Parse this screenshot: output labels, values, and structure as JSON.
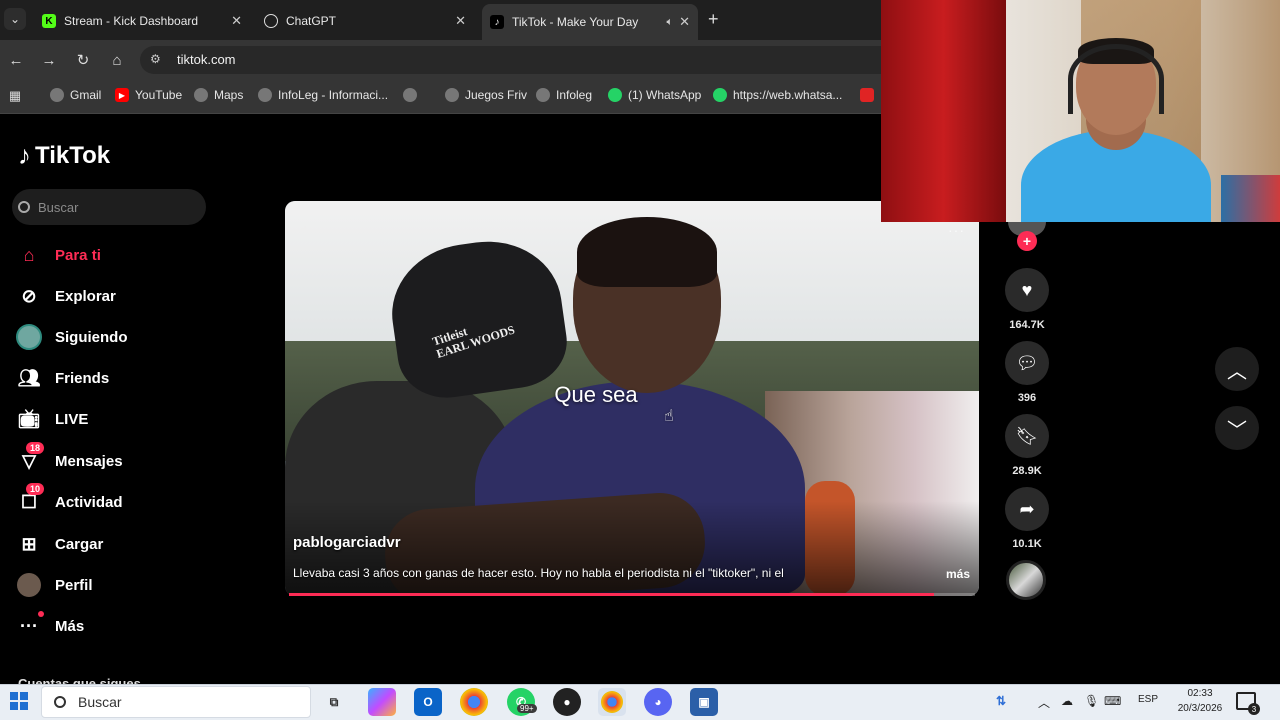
{
  "browser": {
    "tabs": [
      {
        "title": "Stream - Kick Dashboard",
        "favicon": "K",
        "favicon_color": "#53fc18"
      },
      {
        "title": "ChatGPT",
        "favicon": "✦",
        "favicon_color": "#ffffff"
      },
      {
        "title": "TikTok - Make Your Day",
        "favicon": "♪",
        "favicon_color": "#ffffff"
      }
    ],
    "url": "tiktok.com",
    "bookmarks": [
      {
        "label": "Gmail",
        "icon": "globe-icon"
      },
      {
        "label": "YouTube",
        "icon": "youtube-icon"
      },
      {
        "label": "Maps",
        "icon": "globe-icon"
      },
      {
        "label": "InfoLeg - Informaci...",
        "icon": "globe-icon"
      },
      {
        "label": "",
        "icon": "globe-icon"
      },
      {
        "label": "Juegos Friv",
        "icon": "globe-icon"
      },
      {
        "label": "Infoleg",
        "icon": "globe-icon"
      },
      {
        "label": "(1) WhatsApp",
        "icon": "whatsapp-icon"
      },
      {
        "label": "https://web.whatsa...",
        "icon": "whatsapp-icon"
      }
    ]
  },
  "tiktok": {
    "brand": "TikTok",
    "search_placeholder": "Buscar",
    "nav": [
      {
        "label": "Para ti",
        "icon": "home-icon",
        "active": true
      },
      {
        "label": "Explorar",
        "icon": "compass-icon"
      },
      {
        "label": "Siguiendo",
        "icon": "following-avatar-icon"
      },
      {
        "label": "Friends",
        "icon": "friends-icon"
      },
      {
        "label": "LIVE",
        "icon": "live-icon"
      },
      {
        "label": "Mensajes",
        "icon": "messages-icon",
        "badge": "18"
      },
      {
        "label": "Actividad",
        "icon": "activity-icon",
        "badge": "10"
      },
      {
        "label": "Cargar",
        "icon": "upload-icon"
      },
      {
        "label": "Perfil",
        "icon": "profile-avatar-icon"
      },
      {
        "label": "Más",
        "icon": "more-icon"
      }
    ],
    "following_section_title": "Cuentas que sigues",
    "video": {
      "caption_overlay": "Que sea",
      "cap_text_1": "Titleist",
      "cap_text_2": "EARL WOODS",
      "username": "pablogarciadvr",
      "description": "Llevaba casi 3 años con ganas de hacer esto. Hoy no habla el periodista ni el \"tiktoker\", ni el",
      "more_label": "más",
      "progress_fraction": 0.94
    },
    "actions": {
      "likes": "164.7K",
      "comments": "396",
      "saves": "28.9K",
      "shares": "10.1K"
    }
  },
  "taskbar": {
    "search_placeholder": "Buscar",
    "whatsapp_badge": "99+",
    "language": "ESP",
    "time": "02:33",
    "date": "20/3/2026",
    "notifications": "3"
  },
  "colors": {
    "accent": "#fe2c55",
    "tiktok_bg": "#000000"
  }
}
